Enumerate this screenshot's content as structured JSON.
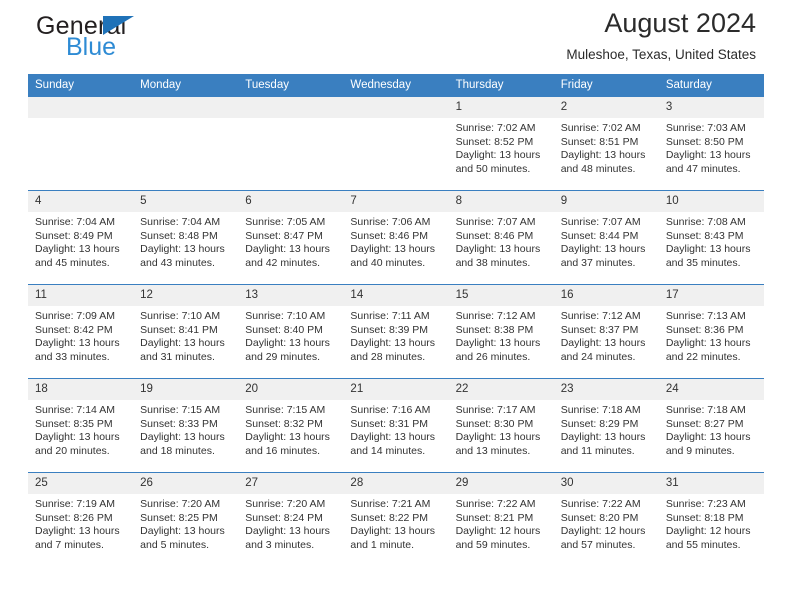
{
  "brand": {
    "name_part1": "General",
    "name_part2": "Blue",
    "triangle_color": "#1f72b8",
    "blue_color": "#2e8bd4"
  },
  "header": {
    "title": "August 2024",
    "subtitle": "Muleshoe, Texas, United States"
  },
  "theme": {
    "header_bg": "#3a7fc0",
    "daynum_bg": "#f0f0f0",
    "text_color": "#333333"
  },
  "weekday_headers": [
    "Sunday",
    "Monday",
    "Tuesday",
    "Wednesday",
    "Thursday",
    "Friday",
    "Saturday"
  ],
  "weeks": [
    {
      "days": [
        {
          "num": "",
          "lines": []
        },
        {
          "num": "",
          "lines": []
        },
        {
          "num": "",
          "lines": []
        },
        {
          "num": "",
          "lines": []
        },
        {
          "num": "1",
          "lines": [
            "Sunrise: 7:02 AM",
            "Sunset: 8:52 PM",
            "Daylight: 13 hours",
            "and 50 minutes."
          ]
        },
        {
          "num": "2",
          "lines": [
            "Sunrise: 7:02 AM",
            "Sunset: 8:51 PM",
            "Daylight: 13 hours",
            "and 48 minutes."
          ]
        },
        {
          "num": "3",
          "lines": [
            "Sunrise: 7:03 AM",
            "Sunset: 8:50 PM",
            "Daylight: 13 hours",
            "and 47 minutes."
          ]
        }
      ]
    },
    {
      "days": [
        {
          "num": "4",
          "lines": [
            "Sunrise: 7:04 AM",
            "Sunset: 8:49 PM",
            "Daylight: 13 hours",
            "and 45 minutes."
          ]
        },
        {
          "num": "5",
          "lines": [
            "Sunrise: 7:04 AM",
            "Sunset: 8:48 PM",
            "Daylight: 13 hours",
            "and 43 minutes."
          ]
        },
        {
          "num": "6",
          "lines": [
            "Sunrise: 7:05 AM",
            "Sunset: 8:47 PM",
            "Daylight: 13 hours",
            "and 42 minutes."
          ]
        },
        {
          "num": "7",
          "lines": [
            "Sunrise: 7:06 AM",
            "Sunset: 8:46 PM",
            "Daylight: 13 hours",
            "and 40 minutes."
          ]
        },
        {
          "num": "8",
          "lines": [
            "Sunrise: 7:07 AM",
            "Sunset: 8:46 PM",
            "Daylight: 13 hours",
            "and 38 minutes."
          ]
        },
        {
          "num": "9",
          "lines": [
            "Sunrise: 7:07 AM",
            "Sunset: 8:44 PM",
            "Daylight: 13 hours",
            "and 37 minutes."
          ]
        },
        {
          "num": "10",
          "lines": [
            "Sunrise: 7:08 AM",
            "Sunset: 8:43 PM",
            "Daylight: 13 hours",
            "and 35 minutes."
          ]
        }
      ]
    },
    {
      "days": [
        {
          "num": "11",
          "lines": [
            "Sunrise: 7:09 AM",
            "Sunset: 8:42 PM",
            "Daylight: 13 hours",
            "and 33 minutes."
          ]
        },
        {
          "num": "12",
          "lines": [
            "Sunrise: 7:10 AM",
            "Sunset: 8:41 PM",
            "Daylight: 13 hours",
            "and 31 minutes."
          ]
        },
        {
          "num": "13",
          "lines": [
            "Sunrise: 7:10 AM",
            "Sunset: 8:40 PM",
            "Daylight: 13 hours",
            "and 29 minutes."
          ]
        },
        {
          "num": "14",
          "lines": [
            "Sunrise: 7:11 AM",
            "Sunset: 8:39 PM",
            "Daylight: 13 hours",
            "and 28 minutes."
          ]
        },
        {
          "num": "15",
          "lines": [
            "Sunrise: 7:12 AM",
            "Sunset: 8:38 PM",
            "Daylight: 13 hours",
            "and 26 minutes."
          ]
        },
        {
          "num": "16",
          "lines": [
            "Sunrise: 7:12 AM",
            "Sunset: 8:37 PM",
            "Daylight: 13 hours",
            "and 24 minutes."
          ]
        },
        {
          "num": "17",
          "lines": [
            "Sunrise: 7:13 AM",
            "Sunset: 8:36 PM",
            "Daylight: 13 hours",
            "and 22 minutes."
          ]
        }
      ]
    },
    {
      "days": [
        {
          "num": "18",
          "lines": [
            "Sunrise: 7:14 AM",
            "Sunset: 8:35 PM",
            "Daylight: 13 hours",
            "and 20 minutes."
          ]
        },
        {
          "num": "19",
          "lines": [
            "Sunrise: 7:15 AM",
            "Sunset: 8:33 PM",
            "Daylight: 13 hours",
            "and 18 minutes."
          ]
        },
        {
          "num": "20",
          "lines": [
            "Sunrise: 7:15 AM",
            "Sunset: 8:32 PM",
            "Daylight: 13 hours",
            "and 16 minutes."
          ]
        },
        {
          "num": "21",
          "lines": [
            "Sunrise: 7:16 AM",
            "Sunset: 8:31 PM",
            "Daylight: 13 hours",
            "and 14 minutes."
          ]
        },
        {
          "num": "22",
          "lines": [
            "Sunrise: 7:17 AM",
            "Sunset: 8:30 PM",
            "Daylight: 13 hours",
            "and 13 minutes."
          ]
        },
        {
          "num": "23",
          "lines": [
            "Sunrise: 7:18 AM",
            "Sunset: 8:29 PM",
            "Daylight: 13 hours",
            "and 11 minutes."
          ]
        },
        {
          "num": "24",
          "lines": [
            "Sunrise: 7:18 AM",
            "Sunset: 8:27 PM",
            "Daylight: 13 hours",
            "and 9 minutes."
          ]
        }
      ]
    },
    {
      "days": [
        {
          "num": "25",
          "lines": [
            "Sunrise: 7:19 AM",
            "Sunset: 8:26 PM",
            "Daylight: 13 hours",
            "and 7 minutes."
          ]
        },
        {
          "num": "26",
          "lines": [
            "Sunrise: 7:20 AM",
            "Sunset: 8:25 PM",
            "Daylight: 13 hours",
            "and 5 minutes."
          ]
        },
        {
          "num": "27",
          "lines": [
            "Sunrise: 7:20 AM",
            "Sunset: 8:24 PM",
            "Daylight: 13 hours",
            "and 3 minutes."
          ]
        },
        {
          "num": "28",
          "lines": [
            "Sunrise: 7:21 AM",
            "Sunset: 8:22 PM",
            "Daylight: 13 hours",
            "and 1 minute."
          ]
        },
        {
          "num": "29",
          "lines": [
            "Sunrise: 7:22 AM",
            "Sunset: 8:21 PM",
            "Daylight: 12 hours",
            "and 59 minutes."
          ]
        },
        {
          "num": "30",
          "lines": [
            "Sunrise: 7:22 AM",
            "Sunset: 8:20 PM",
            "Daylight: 12 hours",
            "and 57 minutes."
          ]
        },
        {
          "num": "31",
          "lines": [
            "Sunrise: 7:23 AM",
            "Sunset: 8:18 PM",
            "Daylight: 12 hours",
            "and 55 minutes."
          ]
        }
      ]
    }
  ]
}
